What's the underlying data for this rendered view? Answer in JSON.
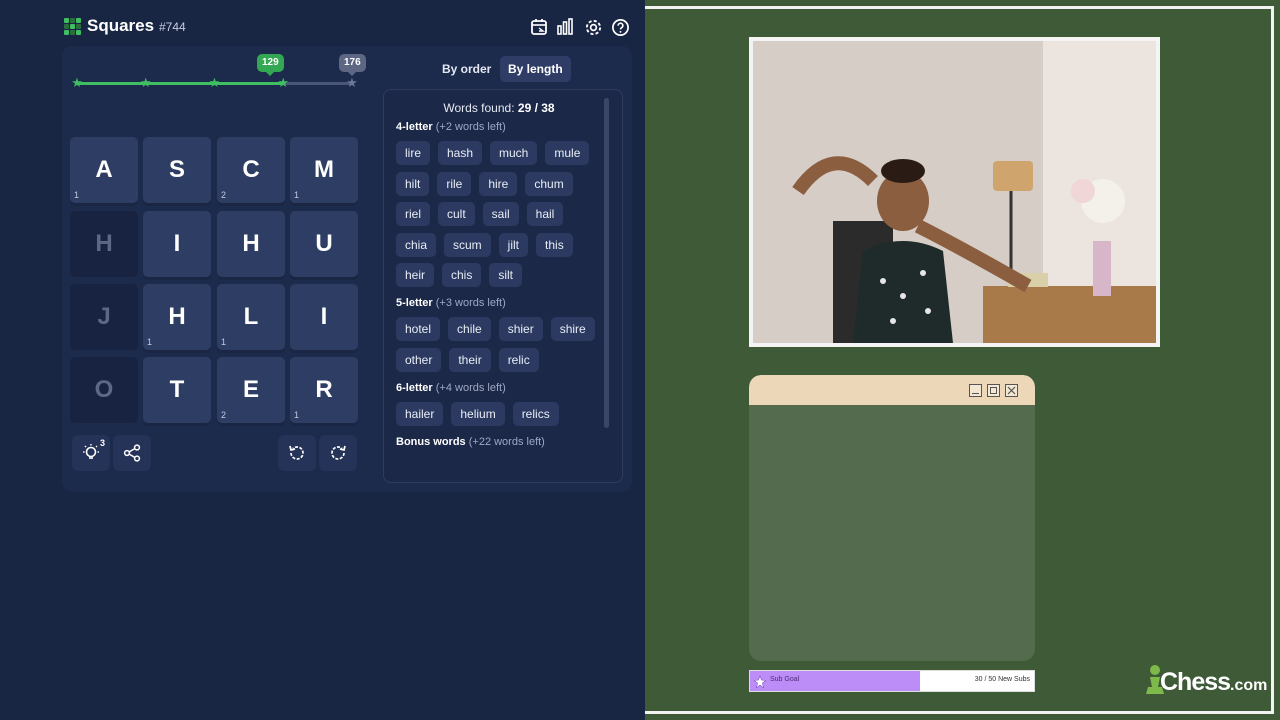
{
  "game": {
    "title": "Squares",
    "puzzle_number": "#744",
    "progress": {
      "current_points": 129,
      "max_points": 176,
      "bubble_current": "129",
      "bubble_max": "176",
      "stars_reached": 4,
      "stars_total": 5,
      "fill_fraction": 0.75
    },
    "grid": [
      [
        {
          "letter": "A",
          "count": "1"
        },
        {
          "letter": "S",
          "count": ""
        },
        {
          "letter": "C",
          "count": "2"
        },
        {
          "letter": "M",
          "count": "1"
        }
      ],
      [
        {
          "letter": "H",
          "count": "",
          "dim": true
        },
        {
          "letter": "I",
          "count": ""
        },
        {
          "letter": "H",
          "count": ""
        },
        {
          "letter": "U",
          "count": ""
        }
      ],
      [
        {
          "letter": "J",
          "count": "",
          "dim": true
        },
        {
          "letter": "H",
          "count": "1"
        },
        {
          "letter": "L",
          "count": "1"
        },
        {
          "letter": "I",
          "count": ""
        }
      ],
      [
        {
          "letter": "O",
          "count": "",
          "dim": true
        },
        {
          "letter": "T",
          "count": ""
        },
        {
          "letter": "E",
          "count": "2"
        },
        {
          "letter": "R",
          "count": "1"
        }
      ]
    ],
    "hints_left": "3",
    "sort": {
      "by_order_label": "By order",
      "by_length_label": "By length",
      "active": "By length"
    },
    "words": {
      "found_label": "Words found:",
      "found_count": "29 / 38",
      "sections": [
        {
          "title": "4-letter",
          "left": "(+2 words left)",
          "words": [
            "lire",
            "hash",
            "much",
            "mule",
            "hilt",
            "rile",
            "hire",
            "chum",
            "riel",
            "cult",
            "sail",
            "hail",
            "chia",
            "scum",
            "jilt",
            "this",
            "heir",
            "chis",
            "silt"
          ]
        },
        {
          "title": "5-letter",
          "left": "(+3 words left)",
          "words": [
            "hotel",
            "chile",
            "shier",
            "shire",
            "other",
            "their",
            "relic"
          ]
        },
        {
          "title": "6-letter",
          "left": "(+4 words left)",
          "words": [
            "hailer",
            "helium",
            "relics"
          ]
        },
        {
          "title": "Bonus words",
          "left": "(+22 words left)",
          "words": []
        }
      ]
    }
  },
  "overlay": {
    "sub_goal_label": "Sub Goal",
    "sub_goal_count": "30 / 50 New Subs",
    "sub_goal_fraction": 0.6,
    "sponsor_logo": "Chess",
    "sponsor_suffix": ".com",
    "colors": {
      "frame_bg": "#3e5a37",
      "chat_bg": "#546b4d",
      "chat_titlebar": "#ecd7b9",
      "subgoal_fill": "#bd8df7"
    }
  },
  "icons": [
    "calendar-icon",
    "bar-chart-icon",
    "gear-icon",
    "help-icon",
    "lightbulb-icon",
    "share-icon",
    "undo-icon",
    "redo-icon",
    "minimize-icon",
    "maximize-icon",
    "close-icon",
    "pawn-icon"
  ]
}
